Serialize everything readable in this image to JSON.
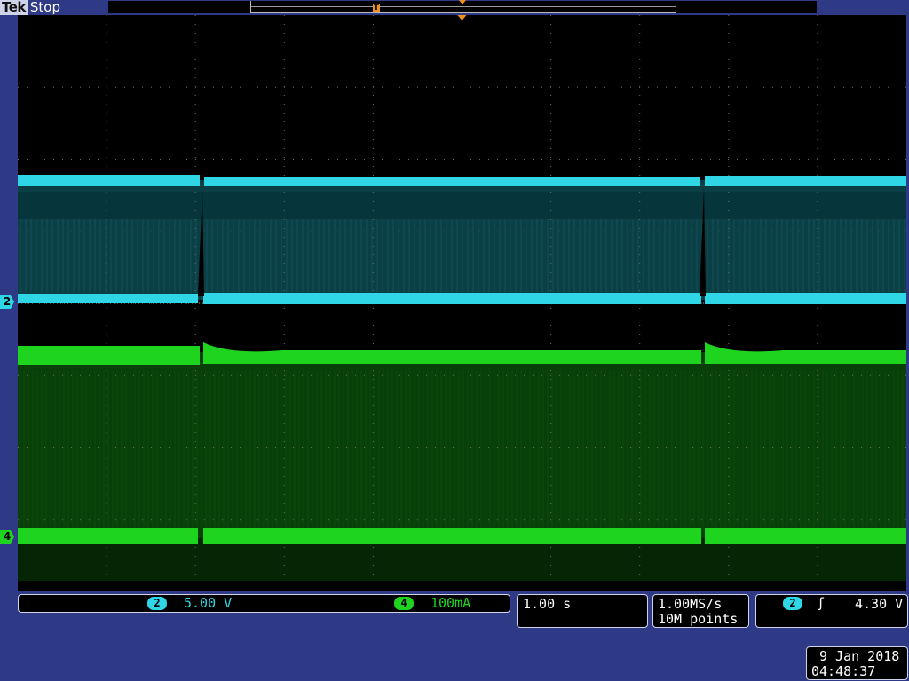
{
  "header": {
    "brand": "Tek",
    "run_state": "Stop"
  },
  "trigger_position_marker": "T",
  "channels": [
    {
      "id": "2",
      "scale": "5.00 V",
      "color": "#2ed6e6"
    },
    {
      "id": "4",
      "scale": "100mA",
      "color": "#1fd41f"
    }
  ],
  "timebase": {
    "per_div": "1.00 s"
  },
  "acquisition": {
    "sample_rate": "1.00MS/s",
    "record_length": "10M points"
  },
  "trigger": {
    "source": "2",
    "slope_icon": "rising-edge-icon",
    "slope_glyph": "ʃ",
    "level": "4.30 V"
  },
  "datetime": {
    "date": "9 Jan  2018",
    "time": "04:48:37"
  },
  "waveform": {
    "transitions_s": [
      2.07,
      7.71
    ],
    "record_span_s": 10
  }
}
